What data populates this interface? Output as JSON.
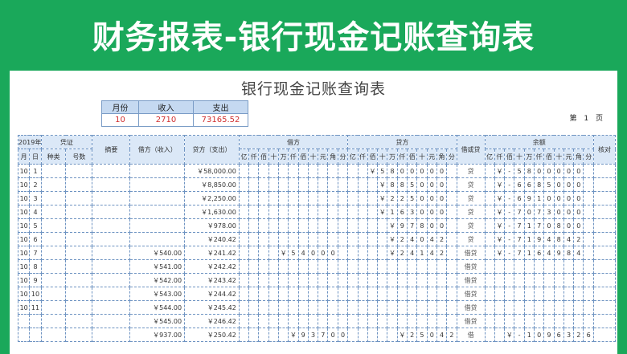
{
  "banner": {
    "title": "财务报表-银行现金记账查询表"
  },
  "doc_title": "银行现金记账查询表",
  "summary": {
    "headers": [
      "月份",
      "收入",
      "支出"
    ],
    "values": [
      "10",
      "2710",
      "73165.52"
    ]
  },
  "page": {
    "label": "第",
    "number": "1",
    "unit": "页"
  },
  "ledger": {
    "year": "2019年",
    "voucher": "凭证",
    "summary_col": "摘要",
    "debit_amount": "借方（收入）",
    "credit_amount": "贷方（支出）",
    "debit": "借方",
    "credit": "贷方",
    "dc": "借或贷",
    "balance": "余额",
    "check": "核对",
    "sub": {
      "month": "月",
      "day": "日",
      "kind": "种类",
      "number": "号数"
    },
    "digit_labels": [
      "亿",
      "仟",
      "佰",
      "十",
      "万",
      "仟",
      "佰",
      "十",
      "元",
      "角",
      "分"
    ],
    "rows": [
      {
        "m": "10",
        "d": "1",
        "in": "",
        "out": "￥58,000.00",
        "dr": [
          "",
          "",
          "",
          "",
          "",
          "",
          "",
          "",
          "",
          "",
          ""
        ],
        "cr": [
          "",
          "",
          "￥",
          "5",
          "8",
          "0",
          "0",
          "0",
          "0",
          "0",
          ""
        ],
        "dc": "贷",
        "bal": [
          "",
          "￥",
          "-",
          "5",
          "8",
          "0",
          "0",
          "0",
          "0",
          "0",
          ""
        ]
      },
      {
        "m": "10",
        "d": "2",
        "in": "",
        "out": "￥8,850.00",
        "dr": [
          "",
          "",
          "",
          "",
          "",
          "",
          "",
          "",
          "",
          "",
          ""
        ],
        "cr": [
          "",
          "",
          "",
          "￥",
          "8",
          "8",
          "5",
          "0",
          "0",
          "0",
          ""
        ],
        "dc": "贷",
        "bal": [
          "",
          "￥",
          "-",
          "6",
          "6",
          "8",
          "5",
          "0",
          "0",
          "0",
          ""
        ]
      },
      {
        "m": "10",
        "d": "3",
        "in": "",
        "out": "￥2,250.00",
        "dr": [
          "",
          "",
          "",
          "",
          "",
          "",
          "",
          "",
          "",
          "",
          ""
        ],
        "cr": [
          "",
          "",
          "",
          "￥",
          "2",
          "2",
          "5",
          "0",
          "0",
          "0",
          ""
        ],
        "dc": "贷",
        "bal": [
          "",
          "￥",
          "-",
          "6",
          "9",
          "1",
          "0",
          "0",
          "0",
          "0",
          ""
        ]
      },
      {
        "m": "10",
        "d": "4",
        "in": "",
        "out": "￥1,630.00",
        "dr": [
          "",
          "",
          "",
          "",
          "",
          "",
          "",
          "",
          "",
          "",
          ""
        ],
        "cr": [
          "",
          "",
          "",
          "￥",
          "1",
          "6",
          "3",
          "0",
          "0",
          "0",
          ""
        ],
        "dc": "贷",
        "bal": [
          "",
          "￥",
          "-",
          "7",
          "0",
          "7",
          "3",
          "0",
          "0",
          "0",
          ""
        ]
      },
      {
        "m": "10",
        "d": "5",
        "in": "",
        "out": "￥978.00",
        "dr": [
          "",
          "",
          "",
          "",
          "",
          "",
          "",
          "",
          "",
          "",
          ""
        ],
        "cr": [
          "",
          "",
          "",
          "",
          "￥",
          "9",
          "7",
          "8",
          "0",
          "0",
          ""
        ],
        "dc": "贷",
        "bal": [
          "",
          "￥",
          "-",
          "7",
          "1",
          "7",
          "0",
          "8",
          "0",
          "0",
          ""
        ]
      },
      {
        "m": "10",
        "d": "6",
        "in": "",
        "out": "￥240.42",
        "dr": [
          "",
          "",
          "",
          "",
          "",
          "",
          "",
          "",
          "",
          "",
          ""
        ],
        "cr": [
          "",
          "",
          "",
          "",
          "￥",
          "2",
          "4",
          "0",
          "4",
          "2",
          ""
        ],
        "dc": "贷",
        "bal": [
          "",
          "￥",
          "-",
          "7",
          "1",
          "9",
          "4",
          "8",
          "4",
          "2",
          ""
        ]
      },
      {
        "m": "10",
        "d": "7",
        "in": "￥540.00",
        "out": "￥241.42",
        "dr": [
          "",
          "",
          "",
          "",
          "￥",
          "5",
          "4",
          "0",
          "0",
          "0",
          ""
        ],
        "cr": [
          "",
          "",
          "",
          "",
          "￥",
          "2",
          "4",
          "1",
          "4",
          "2",
          ""
        ],
        "dc": "借贷",
        "bal": [
          "",
          "￥",
          "-",
          "7",
          "1",
          "6",
          "4",
          "9",
          "8",
          "4",
          ""
        ]
      },
      {
        "m": "10",
        "d": "8",
        "in": "￥541.00",
        "out": "￥242.42",
        "dr": [
          "",
          "",
          "",
          "",
          "",
          "",
          "",
          "",
          "",
          "",
          ""
        ],
        "cr": [
          "",
          "",
          "",
          "",
          "",
          "",
          "",
          "",
          "",
          "",
          ""
        ],
        "dc": "借贷",
        "bal": [
          "",
          "",
          "",
          "",
          "",
          "",
          "",
          "",
          "",
          "",
          ""
        ]
      },
      {
        "m": "10",
        "d": "9",
        "in": "￥542.00",
        "out": "￥243.42",
        "dr": [
          "",
          "",
          "",
          "",
          "",
          "",
          "",
          "",
          "",
          "",
          ""
        ],
        "cr": [
          "",
          "",
          "",
          "",
          "",
          "",
          "",
          "",
          "",
          "",
          ""
        ],
        "dc": "借贷",
        "bal": [
          "",
          "",
          "",
          "",
          "",
          "",
          "",
          "",
          "",
          "",
          ""
        ]
      },
      {
        "m": "10",
        "d": "10",
        "in": "￥543.00",
        "out": "￥244.42",
        "dr": [
          "",
          "",
          "",
          "",
          "",
          "",
          "",
          "",
          "",
          "",
          ""
        ],
        "cr": [
          "",
          "",
          "",
          "",
          "",
          "",
          "",
          "",
          "",
          "",
          ""
        ],
        "dc": "借贷",
        "bal": [
          "",
          "",
          "",
          "",
          "",
          "",
          "",
          "",
          "",
          "",
          ""
        ]
      },
      {
        "m": "10",
        "d": "11",
        "in": "￥544.00",
        "out": "￥245.42",
        "dr": [
          "",
          "",
          "",
          "",
          "",
          "",
          "",
          "",
          "",
          "",
          ""
        ],
        "cr": [
          "",
          "",
          "",
          "",
          "",
          "",
          "",
          "",
          "",
          "",
          ""
        ],
        "dc": "借贷",
        "bal": [
          "",
          "",
          "",
          "",
          "",
          "",
          "",
          "",
          "",
          "",
          ""
        ]
      },
      {
        "m": "",
        "d": "",
        "in": "￥545.00",
        "out": "￥246.42",
        "dr": [
          "",
          "",
          "",
          "",
          "",
          "",
          "",
          "",
          "",
          "",
          ""
        ],
        "cr": [
          "",
          "",
          "",
          "",
          "",
          "",
          "",
          "",
          "",
          "",
          ""
        ],
        "dc": "借贷",
        "bal": [
          "",
          "",
          "",
          "",
          "",
          "",
          "",
          "",
          "",
          "",
          ""
        ]
      },
      {
        "m": "",
        "d": "",
        "in": "￥937.00",
        "out": "￥250.42",
        "dr": [
          "",
          "",
          "",
          "",
          "",
          "￥",
          "9",
          "3",
          "7",
          "0",
          "0"
        ],
        "cr": [
          "",
          "",
          "",
          "",
          "",
          "￥",
          "2",
          "5",
          "0",
          "4",
          "2"
        ],
        "dc": "借",
        "bal": [
          "",
          "",
          "￥",
          "-",
          "1",
          "0",
          "9",
          "6",
          "3",
          "2",
          "6"
        ]
      }
    ]
  }
}
